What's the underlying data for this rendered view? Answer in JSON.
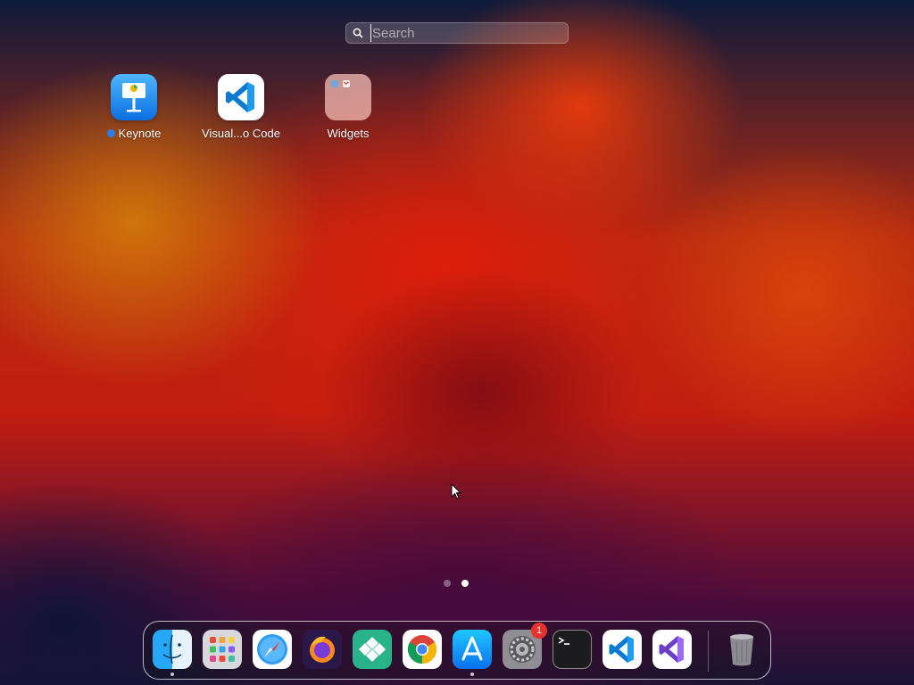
{
  "search": {
    "placeholder": "Search",
    "value": ""
  },
  "apps": [
    {
      "label": "Keynote",
      "icon": "keynote-icon",
      "new": true
    },
    {
      "label": "Visual...o Code",
      "icon": "vscode-icon"
    },
    {
      "label": "Widgets",
      "icon": "folder-icon"
    }
  ],
  "pager": {
    "pages": 2,
    "current": 2
  },
  "dock": {
    "items": [
      {
        "name": "Finder",
        "icon": "finder-icon",
        "running": true
      },
      {
        "name": "Launchpad",
        "icon": "launchpad-icon"
      },
      {
        "name": "Safari",
        "icon": "safari-icon"
      },
      {
        "name": "Firefox",
        "icon": "firefox-icon"
      },
      {
        "name": "Pinned app",
        "icon": "diamond-app-icon"
      },
      {
        "name": "Chrome",
        "icon": "chrome-icon"
      },
      {
        "name": "App Store",
        "icon": "app-store-icon",
        "running": true
      },
      {
        "name": "System Settings",
        "icon": "settings-icon",
        "badge": "1"
      },
      {
        "name": "Terminal",
        "icon": "terminal-icon"
      },
      {
        "name": "Visual Studio Code",
        "icon": "vscode-icon"
      },
      {
        "name": "Visual Studio",
        "icon": "visual-studio-icon"
      },
      {
        "name": "Trash",
        "icon": "trash-icon"
      }
    ],
    "settings_badge": "1"
  },
  "colors": {
    "accent": "#2b7de9",
    "badge": "#e5322d"
  }
}
